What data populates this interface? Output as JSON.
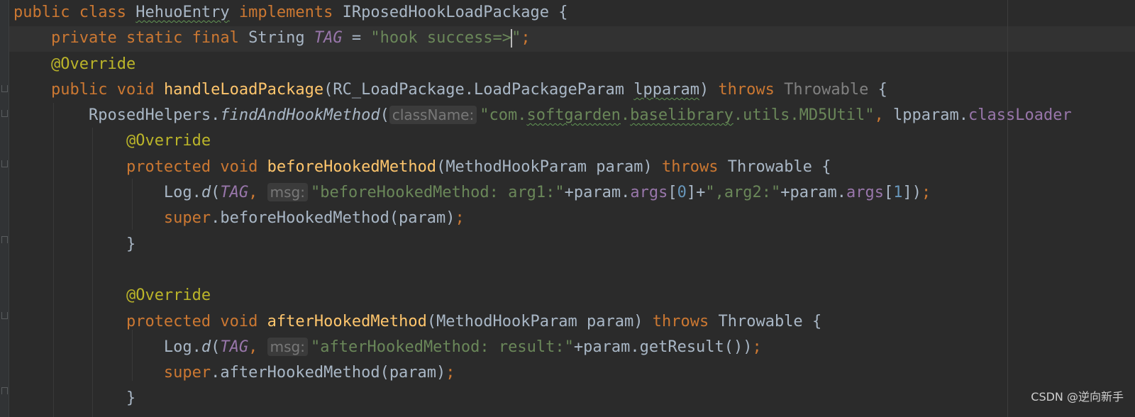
{
  "code": {
    "line1": {
      "kw_public": "public",
      "kw_class": "class",
      "class_name": "HehuoEntry",
      "kw_implements": "implements",
      "interface": "IRposedHookLoadPackage",
      "brace": "{"
    },
    "line2": {
      "modifiers": "private static final",
      "type": "String",
      "name": "TAG",
      "eq": "=",
      "value_start": "\"hook success=>",
      "value_end": "\"",
      "semi": ";"
    },
    "line3": {
      "annotation": "@Override"
    },
    "line4": {
      "modifiers": "public void",
      "method": "handleLoadPackage",
      "open": "(",
      "param_type": "RC_LoadPackage.LoadPackageParam",
      "param_name": "lpparam",
      "close": ")",
      "kw_throws": "throws",
      "throwable": "Throwable",
      "brace": "{"
    },
    "line5": {
      "receiver": "RposedHelpers.",
      "method": "findAndHookMethod",
      "open": "(",
      "hint": "className:",
      "str_q1": "\"com.",
      "str_w1": "softgarden",
      "str_dot1": ".",
      "str_w2": "baselibrary",
      "str_rest": ".utils.MD5Util\"",
      "comma": ",",
      "arg": "lpparam.",
      "field": "classLoader"
    },
    "line6": {
      "annotation": "@Override"
    },
    "line7": {
      "modifiers": "protected void",
      "method": "beforeHookedMethod",
      "open": "(",
      "param_type": "MethodHookParam",
      "param_name": "param",
      "close": ")",
      "kw_throws": "throws",
      "throwable": "Throwable",
      "brace": "{"
    },
    "line8": {
      "log": "Log.",
      "method": "d",
      "open": "(",
      "tag": "TAG",
      "comma": ",",
      "hint": "msg:",
      "str1": "\"beforeHookedMethod: arg1:\"",
      "plus1": "+param.",
      "args1": "args",
      "b1o": "[",
      "idx0": "0",
      "b1c": "]+",
      "str2": "\",arg2:\"",
      "plus2": "+param.",
      "args2": "args",
      "b2o": "[",
      "idx1": "1",
      "b2c": "])",
      "semi": ";"
    },
    "line9": {
      "kw_super": "super",
      "call": ".beforeHookedMethod(param)",
      "semi": ";"
    },
    "line10": {
      "brace": "}"
    },
    "line12": {
      "annotation": "@Override"
    },
    "line13": {
      "modifiers": "protected void",
      "method": "afterHookedMethod",
      "open": "(",
      "param_type": "MethodHookParam",
      "param_name": "param",
      "close": ")",
      "kw_throws": "throws",
      "throwable": "Throwable",
      "brace": "{"
    },
    "line14": {
      "log": "Log.",
      "method": "d",
      "open": "(",
      "tag": "TAG",
      "comma": ",",
      "hint": "msg:",
      "str1": "\"afterHookedMethod: result:\"",
      "rest": "+param.getResult())",
      "semi": ";"
    },
    "line15": {
      "kw_super": "super",
      "call": ".afterHookedMethod(param)",
      "semi": ";"
    },
    "line16": {
      "brace": "}"
    }
  },
  "watermark": "CSDN @逆向新手",
  "colors": {
    "background": "#2b2b2b",
    "keyword": "#cc7832",
    "annotation": "#bbb529",
    "method_decl": "#ffc66d",
    "string": "#6a8759",
    "constant": "#9876aa",
    "number": "#6897bb",
    "default_text": "#a9b7c6"
  },
  "icons": {
    "fold_marker": "fold-marker-icon",
    "typo_underline": "spell-check-underline"
  }
}
